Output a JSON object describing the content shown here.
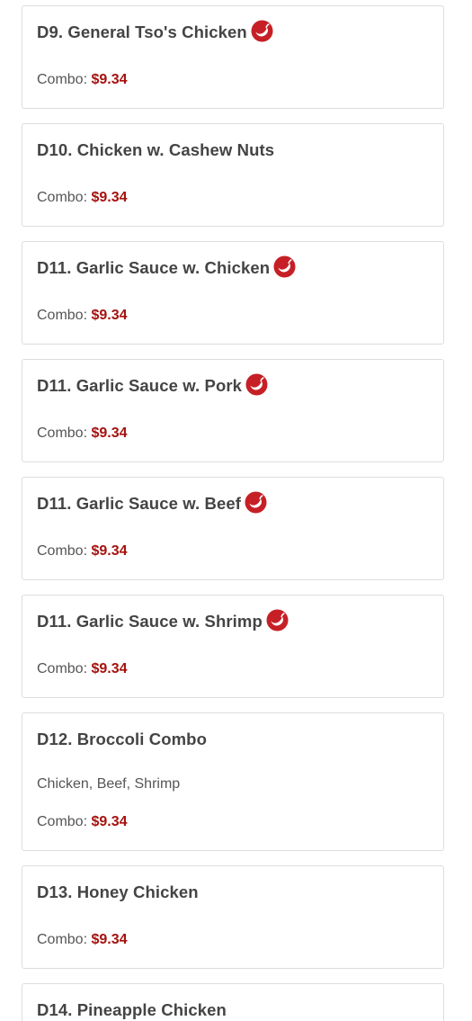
{
  "items": [
    {
      "title": "D9. General Tso's Chicken",
      "spicy": true,
      "description": "",
      "price_label": "Combo:",
      "price": "$9.34"
    },
    {
      "title": "D10. Chicken w. Cashew Nuts",
      "spicy": false,
      "description": "",
      "price_label": "Combo:",
      "price": "$9.34"
    },
    {
      "title": "D11. Garlic Sauce w. Chicken",
      "spicy": true,
      "description": "",
      "price_label": "Combo:",
      "price": "$9.34"
    },
    {
      "title": "D11. Garlic Sauce w. Pork",
      "spicy": true,
      "description": "",
      "price_label": "Combo:",
      "price": "$9.34"
    },
    {
      "title": "D11. Garlic Sauce w. Beef",
      "spicy": true,
      "description": "",
      "price_label": "Combo:",
      "price": "$9.34"
    },
    {
      "title": "D11. Garlic Sauce w. Shrimp",
      "spicy": true,
      "description": "",
      "price_label": "Combo:",
      "price": "$9.34"
    },
    {
      "title": "D12. Broccoli Combo",
      "spicy": false,
      "description": "Chicken, Beef, Shrimp",
      "price_label": "Combo:",
      "price": "$9.34"
    },
    {
      "title": "D13. Honey Chicken",
      "spicy": false,
      "description": "",
      "price_label": "Combo:",
      "price": "$9.34"
    },
    {
      "title": "D14. Pineapple Chicken",
      "spicy": false,
      "description": "",
      "price_label": "",
      "price": ""
    }
  ],
  "icons": {
    "spicy": "hot-pepper-icon"
  },
  "colors": {
    "price": "#a5120f",
    "spicy_badge": "#c62026",
    "title": "#444444",
    "border": "#dddddd"
  }
}
